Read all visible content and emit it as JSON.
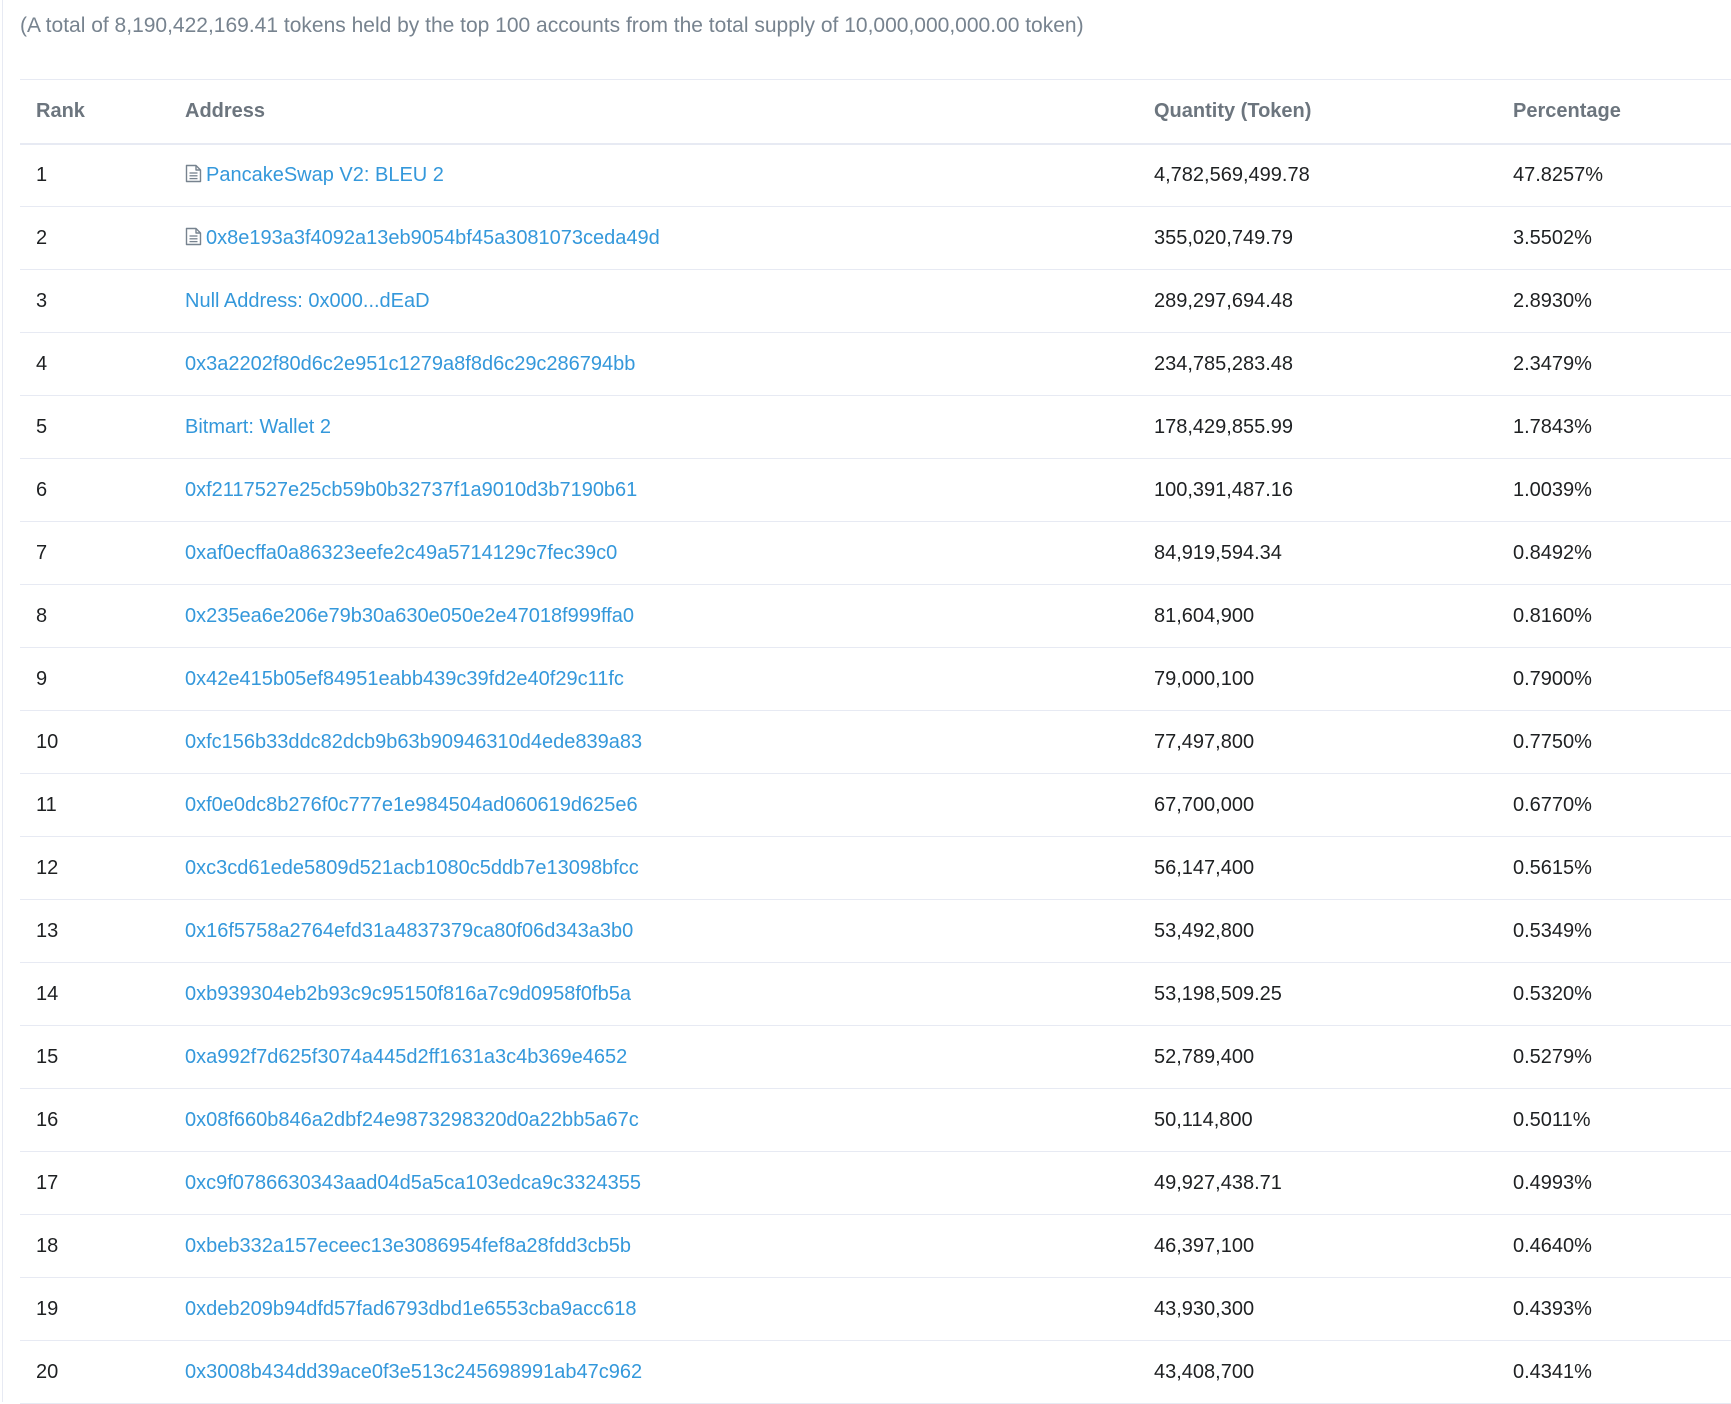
{
  "summary": {
    "text": "(A total of 8,190,422,169.41 tokens held by the top 100 accounts from the total supply of 10,000,000,000.00 token)"
  },
  "table": {
    "headers": {
      "rank": "Rank",
      "address": "Address",
      "quantity": "Quantity (Token)",
      "percentage": "Percentage"
    },
    "rows": [
      {
        "rank": "1",
        "address": "PancakeSwap V2: BLEU 2",
        "contract": true,
        "quantity": "4,782,569,499.78",
        "percentage": "47.8257%"
      },
      {
        "rank": "2",
        "address": "0x8e193a3f4092a13eb9054bf45a3081073ceda49d",
        "contract": true,
        "quantity": "355,020,749.79",
        "percentage": "3.5502%"
      },
      {
        "rank": "3",
        "address": "Null Address: 0x000...dEaD",
        "contract": false,
        "quantity": "289,297,694.48",
        "percentage": "2.8930%"
      },
      {
        "rank": "4",
        "address": "0x3a2202f80d6c2e951c1279a8f8d6c29c286794bb",
        "contract": false,
        "quantity": "234,785,283.48",
        "percentage": "2.3479%"
      },
      {
        "rank": "5",
        "address": "Bitmart: Wallet 2",
        "contract": false,
        "quantity": "178,429,855.99",
        "percentage": "1.7843%"
      },
      {
        "rank": "6",
        "address": "0xf2117527e25cb59b0b32737f1a9010d3b7190b61",
        "contract": false,
        "quantity": "100,391,487.16",
        "percentage": "1.0039%"
      },
      {
        "rank": "7",
        "address": "0xaf0ecffa0a86323eefe2c49a5714129c7fec39c0",
        "contract": false,
        "quantity": "84,919,594.34",
        "percentage": "0.8492%"
      },
      {
        "rank": "8",
        "address": "0x235ea6e206e79b30a630e050e2e47018f999ffa0",
        "contract": false,
        "quantity": "81,604,900",
        "percentage": "0.8160%"
      },
      {
        "rank": "9",
        "address": "0x42e415b05ef84951eabb439c39fd2e40f29c11fc",
        "contract": false,
        "quantity": "79,000,100",
        "percentage": "0.7900%"
      },
      {
        "rank": "10",
        "address": "0xfc156b33ddc82dcb9b63b90946310d4ede839a83",
        "contract": false,
        "quantity": "77,497,800",
        "percentage": "0.7750%"
      },
      {
        "rank": "11",
        "address": "0xf0e0dc8b276f0c777e1e984504ad060619d625e6",
        "contract": false,
        "quantity": "67,700,000",
        "percentage": "0.6770%"
      },
      {
        "rank": "12",
        "address": "0xc3cd61ede5809d521acb1080c5ddb7e13098bfcc",
        "contract": false,
        "quantity": "56,147,400",
        "percentage": "0.5615%"
      },
      {
        "rank": "13",
        "address": "0x16f5758a2764efd31a4837379ca80f06d343a3b0",
        "contract": false,
        "quantity": "53,492,800",
        "percentage": "0.5349%"
      },
      {
        "rank": "14",
        "address": "0xb939304eb2b93c9c95150f816a7c9d0958f0fb5a",
        "contract": false,
        "quantity": "53,198,509.25",
        "percentage": "0.5320%"
      },
      {
        "rank": "15",
        "address": "0xa992f7d625f3074a445d2ff1631a3c4b369e4652",
        "contract": false,
        "quantity": "52,789,400",
        "percentage": "0.5279%"
      },
      {
        "rank": "16",
        "address": "0x08f660b846a2dbf24e9873298320d0a22bb5a67c",
        "contract": false,
        "quantity": "50,114,800",
        "percentage": "0.5011%"
      },
      {
        "rank": "17",
        "address": "0xc9f0786630343aad04d5a5ca103edca9c3324355",
        "contract": false,
        "quantity": "49,927,438.71",
        "percentage": "0.4993%"
      },
      {
        "rank": "18",
        "address": "0xbeb332a157eceec13e3086954fef8a28fdd3cb5b",
        "contract": false,
        "quantity": "46,397,100",
        "percentage": "0.4640%"
      },
      {
        "rank": "19",
        "address": "0xdeb209b94dfd57fad6793dbd1e6553cba9acc618",
        "contract": false,
        "quantity": "43,930,300",
        "percentage": "0.4393%"
      },
      {
        "rank": "20",
        "address": "0x3008b434dd39ace0f3e513c245698991ab47c962",
        "contract": false,
        "quantity": "43,408,700",
        "percentage": "0.4341%"
      }
    ]
  },
  "colors": {
    "link": "#3498db",
    "muted_text": "#77838f",
    "header_text": "#6c757e",
    "border": "#e7eaf3"
  },
  "icons": {
    "contract": "file-text-icon"
  }
}
